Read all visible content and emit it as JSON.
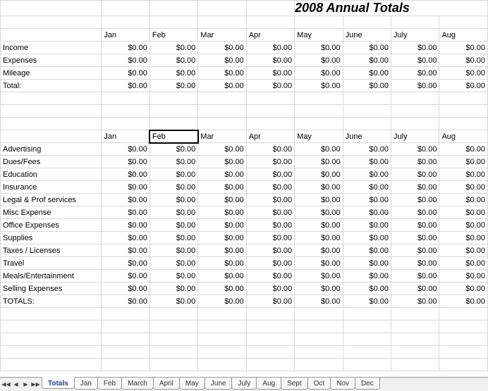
{
  "title": "2008 Annual Totals",
  "months": [
    "Jan",
    "Feb",
    "Mar",
    "Apr",
    "May",
    "June",
    "July",
    "Aug"
  ],
  "section1": {
    "rows": [
      {
        "label": "Income",
        "vals": [
          "$0.00",
          "$0.00",
          "$0.00",
          "$0.00",
          "$0.00",
          "$0.00",
          "$0.00",
          "$0.00"
        ]
      },
      {
        "label": "Expenses",
        "vals": [
          "$0.00",
          "$0.00",
          "$0.00",
          "$0.00",
          "$0.00",
          "$0.00",
          "$0.00",
          "$0.00"
        ]
      },
      {
        "label": "Mileage",
        "vals": [
          "$0.00",
          "$0.00",
          "$0.00",
          "$0.00",
          "$0.00",
          "$0.00",
          "$0.00",
          "$0.00"
        ]
      },
      {
        "label": "Total:",
        "vals": [
          "$0.00",
          "$0.00",
          "$0.00",
          "$0.00",
          "$0.00",
          "$0.00",
          "$0.00",
          "$0.00"
        ]
      }
    ]
  },
  "section2": {
    "rows": [
      {
        "label": "Advertising",
        "vals": [
          "$0.00",
          "$0.00",
          "$0.00",
          "$0.00",
          "$0.00",
          "$0.00",
          "$0.00",
          "$0.00"
        ]
      },
      {
        "label": "Dues/Fees",
        "vals": [
          "$0.00",
          "$0.00",
          "$0.00",
          "$0.00",
          "$0.00",
          "$0.00",
          "$0.00",
          "$0.00"
        ]
      },
      {
        "label": "Education",
        "vals": [
          "$0.00",
          "$0.00",
          "$0.00",
          "$0.00",
          "$0.00",
          "$0.00",
          "$0.00",
          "$0.00"
        ]
      },
      {
        "label": "Insurance",
        "vals": [
          "$0.00",
          "$0.00",
          "$0.00",
          "$0.00",
          "$0.00",
          "$0.00",
          "$0.00",
          "$0.00"
        ]
      },
      {
        "label": "Legal & Prof services",
        "vals": [
          "$0.00",
          "$0.00",
          "$0.00",
          "$0.00",
          "$0.00",
          "$0.00",
          "$0.00",
          "$0.00"
        ]
      },
      {
        "label": "Misc Expense",
        "vals": [
          "$0.00",
          "$0.00",
          "$0.00",
          "$0.00",
          "$0.00",
          "$0.00",
          "$0.00",
          "$0.00"
        ]
      },
      {
        "label": "Office Expenses",
        "vals": [
          "$0.00",
          "$0.00",
          "$0.00",
          "$0.00",
          "$0.00",
          "$0.00",
          "$0.00",
          "$0.00"
        ]
      },
      {
        "label": "Supplies",
        "vals": [
          "$0.00",
          "$0.00",
          "$0.00",
          "$0.00",
          "$0.00",
          "$0.00",
          "$0.00",
          "$0.00"
        ]
      },
      {
        "label": "Taxes / Licenses",
        "vals": [
          "$0.00",
          "$0.00",
          "$0.00",
          "$0.00",
          "$0.00",
          "$0.00",
          "$0.00",
          "$0.00"
        ]
      },
      {
        "label": "Travel",
        "vals": [
          "$0.00",
          "$0.00",
          "$0.00",
          "$0.00",
          "$0.00",
          "$0.00",
          "$0.00",
          "$0.00"
        ]
      },
      {
        "label": "Meals/Entertainment",
        "vals": [
          "$0.00",
          "$0.00",
          "$0.00",
          "$0.00",
          "$0.00",
          "$0.00",
          "$0.00",
          "$0.00"
        ]
      },
      {
        "label": "Selling Expenses",
        "vals": [
          "$0.00",
          "$0.00",
          "$0.00",
          "$0.00",
          "$0.00",
          "$0.00",
          "$0.00",
          "$0.00"
        ]
      },
      {
        "label": "TOTALS:",
        "vals": [
          "$0.00",
          "$0.00",
          "$0.00",
          "$0.00",
          "$0.00",
          "$0.00",
          "$0.00",
          "$0.00"
        ]
      }
    ]
  },
  "selected_cell": {
    "section": 2,
    "header": true,
    "col": 2,
    "value": "Feb"
  },
  "tabs": {
    "active": 0,
    "items": [
      "Totals",
      "Jan",
      "Feb",
      "March",
      "April",
      "May",
      "June",
      "July",
      "Aug",
      "Sept",
      "Oct",
      "Nov",
      "Dec"
    ]
  },
  "chart_data": {
    "type": "table",
    "note": "Spreadsheet of 2008 annual totals by month; all values currently $0.00",
    "months_visible": [
      "Jan",
      "Feb",
      "Mar",
      "Apr",
      "May",
      "June",
      "July",
      "Aug"
    ],
    "summary_rows": [
      "Income",
      "Expenses",
      "Mileage",
      "Total:"
    ],
    "expense_rows": [
      "Advertising",
      "Dues/Fees",
      "Education",
      "Insurance",
      "Legal & Prof services",
      "Misc Expense",
      "Office Expenses",
      "Supplies",
      "Taxes / Licenses",
      "Travel",
      "Meals/Entertainment",
      "Selling Expenses",
      "TOTALS:"
    ],
    "all_values": 0.0,
    "currency": "USD"
  }
}
